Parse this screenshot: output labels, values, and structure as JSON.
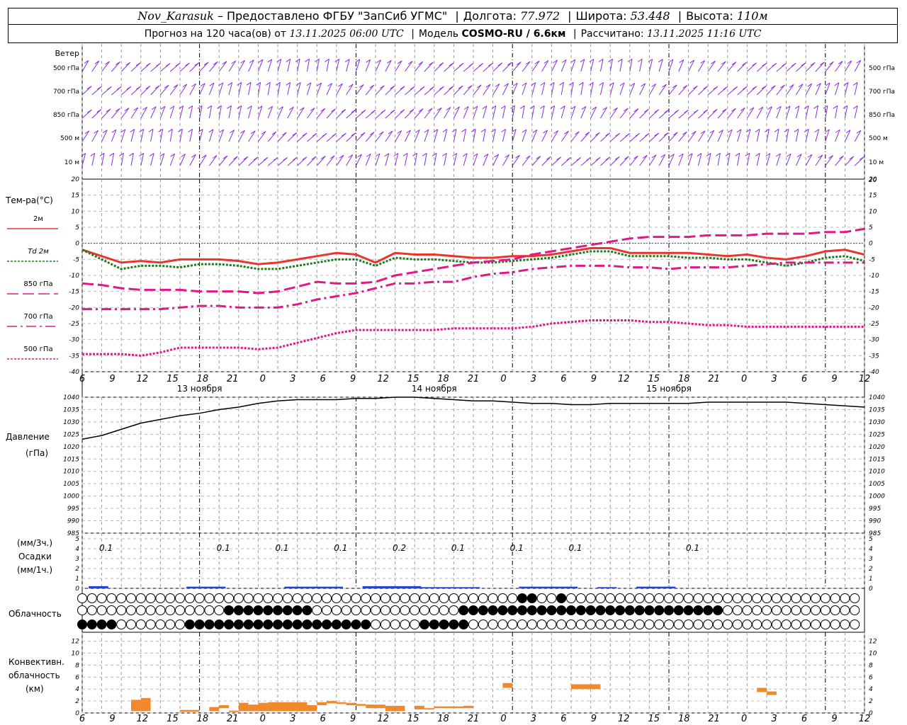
{
  "header": {
    "station": "Nov_Karasuk",
    "provider": "– Предоставлено ФГБУ \"ЗапСиб УГМС\"",
    "lon_label": "Долгота:",
    "lon_value": "77.972",
    "lat_label": "Широта:",
    "lat_value": "53.448",
    "alt_label": "Высота:",
    "alt_value": "110м",
    "forecast_label": "Прогноз на 120 часа(ов) от",
    "forecast_from": "13.11.2025 06:00 UTC",
    "model_label": "Модель",
    "model_value": "COSMO-RU / 6.6км",
    "calc_label": "Рассчитано:",
    "calc_value": "13.11.2025 11:16 UTC"
  },
  "time_axis": {
    "hour_labels": [
      "6",
      "9",
      "12",
      "15",
      "18",
      "21",
      "0",
      "3",
      "6",
      "9",
      "12",
      "15",
      "18",
      "21",
      "0",
      "3",
      "6",
      "9",
      "12",
      "15",
      "18",
      "21",
      "0",
      "3",
      "6",
      "9",
      "12"
    ],
    "day_labels": [
      "13 ноября",
      "14 ноября",
      "15 ноября"
    ]
  },
  "chart_data": [
    {
      "type": "wind-barbs",
      "title": "Ветер",
      "levels": [
        "500 гПа",
        "700 гПа",
        "850 гПа",
        "500 м",
        "10 м"
      ],
      "color": "#8a2be2"
    },
    {
      "type": "line",
      "title": "Тем-ра(°С)",
      "ylim": [
        -40,
        20
      ],
      "y_ticks": [
        20,
        15,
        10,
        5,
        0,
        -5,
        -10,
        -15,
        -20,
        -25,
        -30,
        -35,
        -40
      ],
      "x_hours": [
        0,
        3,
        6,
        9,
        12,
        15,
        18,
        21,
        24,
        27,
        30,
        33,
        36,
        39,
        42,
        45,
        48,
        51,
        54,
        57,
        60,
        63,
        66,
        69,
        72,
        75,
        78,
        81,
        84,
        87,
        90,
        93,
        96,
        99,
        102,
        105,
        108,
        111,
        114,
        117,
        120
      ],
      "series": [
        {
          "name": "2м",
          "color": "#e8352e",
          "dash": "solid",
          "values": [
            -2,
            -4,
            -6,
            -5.5,
            -6,
            -5,
            -5,
            -5,
            -5.5,
            -6.5,
            -6,
            -5,
            -4,
            -3,
            -3.5,
            -6,
            -3,
            -3.5,
            -3.5,
            -4,
            -4.5,
            -4.5,
            -4,
            -4,
            -3.5,
            -2.5,
            -1.5,
            -1.5,
            -3,
            -3,
            -3,
            -3,
            -3.5,
            -4,
            -3.5,
            -4.5,
            -5,
            -4,
            -2.5,
            -2,
            -3.5
          ]
        },
        {
          "name": "Td 2м",
          "color": "#1e7a1e",
          "dash": "dotted",
          "values": [
            -2,
            -5,
            -8,
            -7,
            -7,
            -7.5,
            -6.5,
            -6.5,
            -7,
            -8,
            -8,
            -7,
            -6,
            -5,
            -5,
            -7,
            -4.5,
            -5,
            -5,
            -5.5,
            -6,
            -6,
            -5.5,
            -5,
            -4.5,
            -3.5,
            -2.5,
            -2.5,
            -4,
            -4,
            -4,
            -4.5,
            -4.5,
            -5,
            -5,
            -6,
            -7,
            -6,
            -4.5,
            -4,
            -5.5
          ]
        },
        {
          "name": "850 гПа",
          "color": "#e0188a",
          "dash": "longdash",
          "values": [
            -12.5,
            -13,
            -14,
            -14.5,
            -14.5,
            -14.5,
            -15,
            -15,
            -15,
            -15.5,
            -15,
            -13.5,
            -12,
            -12.5,
            -12.5,
            -12,
            -10,
            -9,
            -8,
            -7,
            -6,
            -5.5,
            -5,
            -3.5,
            -2.5,
            -1.5,
            -0.5,
            0.5,
            1.5,
            2,
            2,
            2,
            2.5,
            2.5,
            2.5,
            3,
            3,
            3,
            3.5,
            3.5,
            4.5
          ]
        },
        {
          "name": "700 гПа",
          "color": "#e0188a",
          "dash": "dashdot",
          "values": [
            -20.5,
            -20.5,
            -20.5,
            -20.5,
            -20.5,
            -20,
            -19.5,
            -19.5,
            -20,
            -20,
            -20,
            -19,
            -17.5,
            -16.5,
            -15.5,
            -14,
            -12.5,
            -12.5,
            -12,
            -12,
            -10.5,
            -9.5,
            -9,
            -8,
            -7.5,
            -7,
            -7,
            -7,
            -7.5,
            -7.5,
            -8,
            -7.5,
            -7.5,
            -7.5,
            -7,
            -6.5,
            -6,
            -6,
            -6,
            -6,
            -6
          ]
        },
        {
          "name": "500 гПа",
          "color": "#e0188a",
          "dash": "dotted",
          "values": [
            -34.5,
            -34.5,
            -34.5,
            -35,
            -34,
            -32.5,
            -32.5,
            -32.5,
            -32.5,
            -33,
            -32.5,
            -31,
            -29.5,
            -28,
            -27,
            -27,
            -27,
            -27,
            -27,
            -26.5,
            -26.5,
            -26.5,
            -26.5,
            -26,
            -25,
            -24.5,
            -24,
            -24,
            -24,
            -24.5,
            -24.5,
            -25,
            -25.5,
            -25.5,
            -26,
            -26,
            -26,
            -26,
            -26,
            -26,
            -26
          ]
        }
      ],
      "legend": [
        "2м",
        "Td 2м",
        "850 гПа",
        "700 гПа",
        "500 гПа"
      ]
    },
    {
      "type": "line",
      "title": "Давление",
      "unit": "(гПа)",
      "ylim": [
        985,
        1040
      ],
      "y_ticks": [
        1040,
        1035,
        1030,
        1025,
        1020,
        1015,
        1010,
        1005,
        1000,
        995,
        990,
        985
      ],
      "x_hours": [
        0,
        3,
        6,
        9,
        12,
        15,
        18,
        21,
        24,
        27,
        30,
        33,
        36,
        39,
        42,
        45,
        48,
        51,
        54,
        57,
        60,
        63,
        66,
        69,
        72,
        75,
        78,
        81,
        84,
        87,
        90,
        93,
        96,
        99,
        102,
        105,
        108,
        111,
        114,
        117,
        120
      ],
      "series": [
        {
          "name": "Давление",
          "color": "#000000",
          "values": [
            1023,
            1024.5,
            1027,
            1029.5,
            1031,
            1032.5,
            1033.5,
            1035,
            1036,
            1037.5,
            1038.5,
            1039,
            1039,
            1039,
            1039.5,
            1039.5,
            1040,
            1040,
            1039.5,
            1039,
            1038.5,
            1038.5,
            1038,
            1037.5,
            1037.5,
            1037,
            1037,
            1037.5,
            1037.5,
            1037.5,
            1037.5,
            1037.5,
            1038,
            1038,
            1038,
            1038,
            1038,
            1037.5,
            1037,
            1036.5,
            1036
          ]
        }
      ]
    },
    {
      "type": "bar",
      "title": "Осадки",
      "ylabel_top": "(мм/3ч.)",
      "ylabel_bottom": "(мм/1ч.)",
      "ylim": [
        0,
        5
      ],
      "y_ticks": [
        5,
        4,
        3,
        2,
        1,
        0
      ],
      "labels": [
        {
          "hour": 1,
          "text": "0.1"
        },
        {
          "hour": 7,
          "text": "0.1"
        },
        {
          "hour": 10,
          "text": "0.1"
        },
        {
          "hour": 13,
          "text": "0.1"
        },
        {
          "hour": 16,
          "text": "0.2"
        },
        {
          "hour": 19,
          "text": "0.1"
        },
        {
          "hour": 22,
          "text": "0.1"
        },
        {
          "hour": 25,
          "text": "0.1"
        },
        {
          "hour": 31,
          "text": "0.1"
        }
      ],
      "bars": [
        {
          "start": 1,
          "end": 2,
          "value": 0.15
        },
        {
          "start": 6,
          "end": 8,
          "value": 0.1
        },
        {
          "start": 11,
          "end": 14,
          "value": 0.1
        },
        {
          "start": 15,
          "end": 18,
          "value": 0.15
        },
        {
          "start": 18,
          "end": 21,
          "value": 0.05
        },
        {
          "start": 23,
          "end": 26,
          "value": 0.1
        },
        {
          "start": 27,
          "end": 28,
          "value": 0.05
        },
        {
          "start": 29,
          "end": 31,
          "value": 0.1
        }
      ],
      "color": "#2244cc"
    },
    {
      "type": "symbols",
      "title": "Облачность",
      "rows": 3
    },
    {
      "type": "bar",
      "title": "Конвективн. облачность",
      "unit": "(км)",
      "ylim": [
        0,
        13
      ],
      "y_ticks": [
        12,
        10,
        8,
        6,
        4,
        2,
        0
      ],
      "color": "#f0892b",
      "bars": [
        {
          "start": 1,
          "end": 2,
          "low": 0.3,
          "high": 2.2
        },
        {
          "start": 2,
          "end": 3,
          "low": 0.3,
          "high": 2.5
        },
        {
          "start": 6,
          "end": 8,
          "low": 0.2,
          "high": 0.5
        },
        {
          "start": 9,
          "end": 10,
          "low": 0.3,
          "high": 1.0
        },
        {
          "start": 10,
          "end": 11,
          "low": 0.8,
          "high": 1.3
        },
        {
          "start": 11,
          "end": 12,
          "low": 0.3,
          "high": 0.4
        },
        {
          "start": 12,
          "end": 13,
          "low": 0.3,
          "high": 1.7
        },
        {
          "start": 13,
          "end": 14,
          "low": 0.3,
          "high": 1.4
        },
        {
          "start": 14,
          "end": 15,
          "low": 0.3,
          "high": 1.7
        },
        {
          "start": 15,
          "end": 19,
          "low": 0.3,
          "high": 1.8
        },
        {
          "start": 19,
          "end": 20,
          "low": 0.3,
          "high": 1.3
        },
        {
          "start": 20,
          "end": 21,
          "low": 1.3,
          "high": 1.8
        },
        {
          "start": 21,
          "end": 22,
          "low": 1.6,
          "high": 2.0
        },
        {
          "start": 22,
          "end": 23,
          "low": 1.5,
          "high": 1.8
        },
        {
          "start": 23,
          "end": 24,
          "low": 1.3,
          "high": 1.7
        },
        {
          "start": 24,
          "end": 25,
          "low": 1.2,
          "high": 1.5
        },
        {
          "start": 25,
          "end": 27,
          "low": 0.8,
          "high": 1.4
        },
        {
          "start": 27,
          "end": 29,
          "low": 0.3,
          "high": 1.2
        },
        {
          "start": 30,
          "end": 31,
          "low": 0.6,
          "high": 1.2
        },
        {
          "start": 31,
          "end": 32,
          "low": 0.6,
          "high": 0.8
        },
        {
          "start": 32,
          "end": 35,
          "low": 0.8,
          "high": 1.1
        },
        {
          "start": 35,
          "end": 36,
          "low": 0.8,
          "high": 1.2
        },
        {
          "start": 39,
          "end": 40,
          "low": 4.2,
          "high": 5.0
        },
        {
          "start": 46,
          "end": 49,
          "low": 4.0,
          "high": 4.8
        },
        {
          "start": 65,
          "end": 66,
          "low": 3.5,
          "high": 4.2
        },
        {
          "start": 66,
          "end": 67,
          "low": 3.0,
          "high": 3.6
        }
      ]
    }
  ]
}
